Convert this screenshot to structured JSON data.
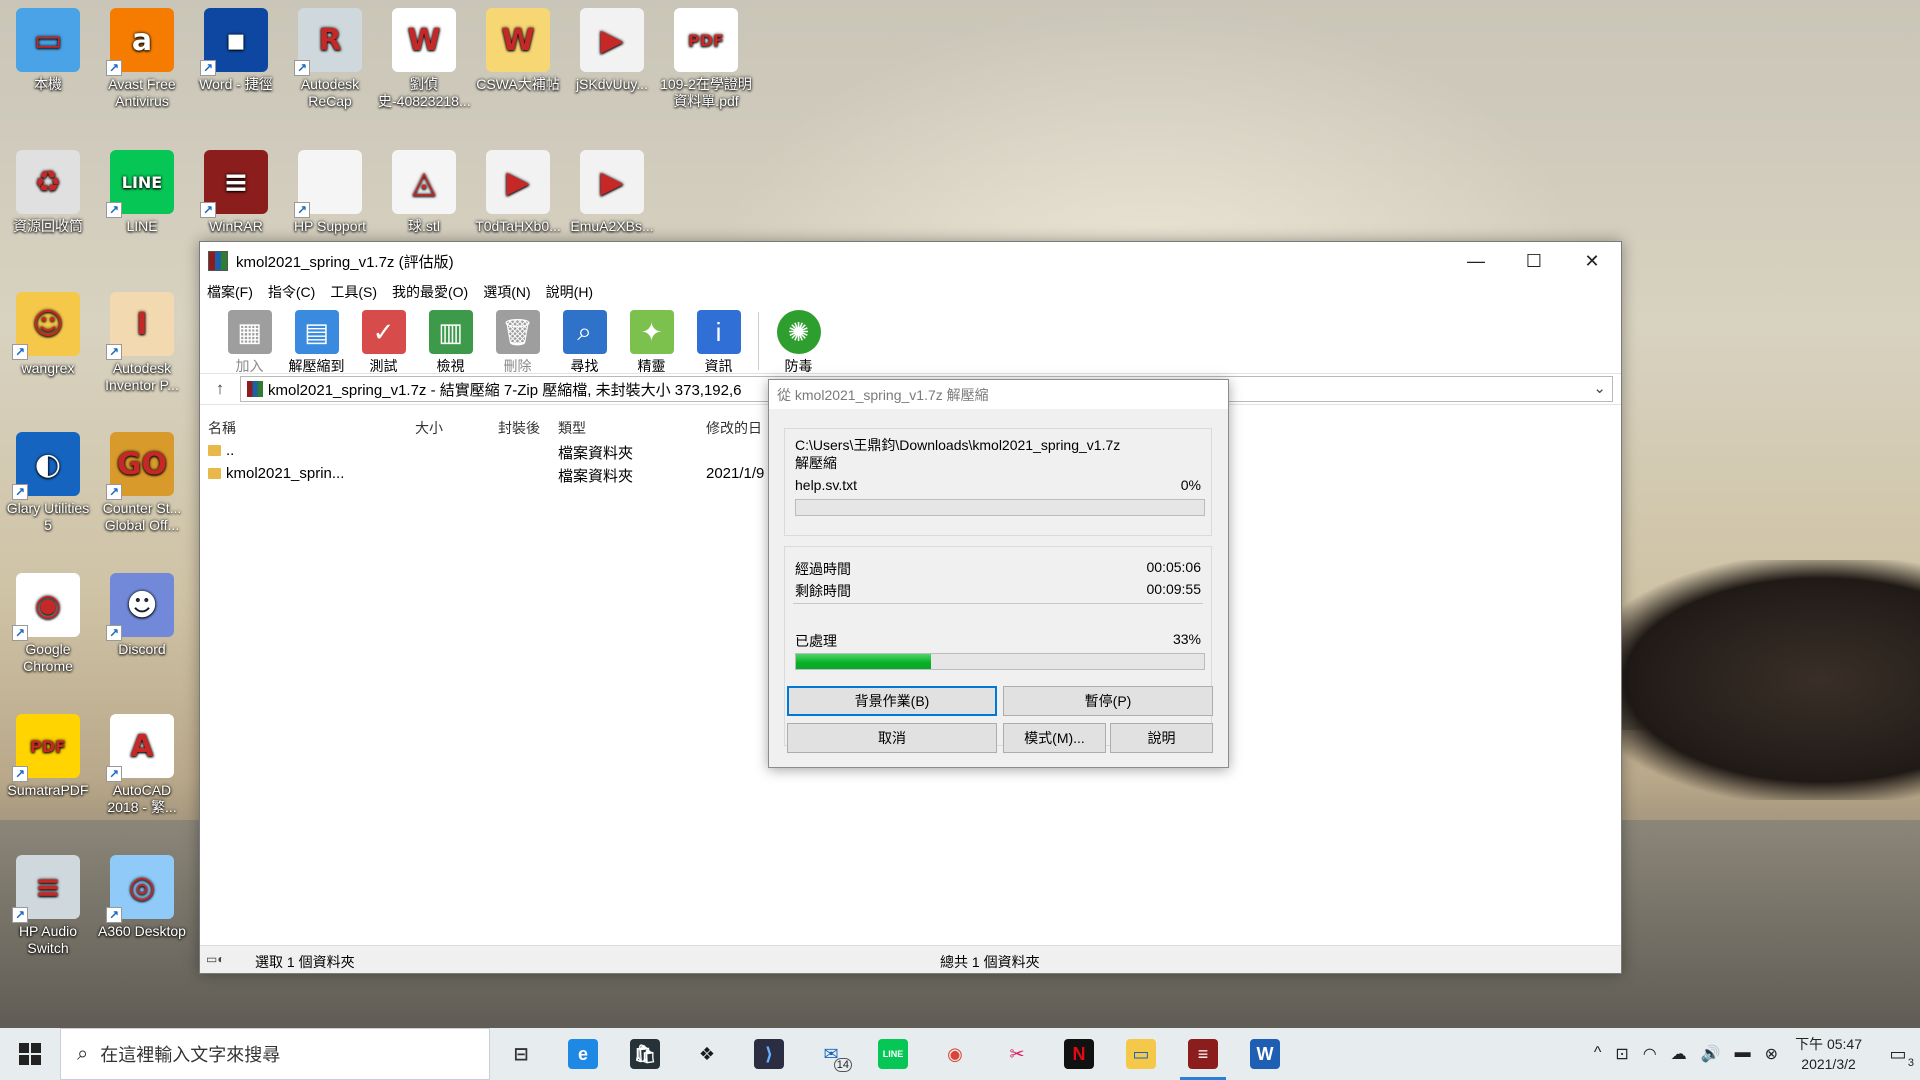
{
  "desktop": {
    "icons": [
      {
        "label": "本機",
        "color": "#4aa3e6",
        "glyph": "▭",
        "name": "this-pc-icon"
      },
      {
        "label": "Avast Free Antivirus",
        "color": "#f57c00",
        "glyph": "a",
        "name": "avast-icon"
      },
      {
        "label": "Word - 捷徑",
        "color": "#0d47a1",
        "glyph": "▪",
        "name": "word-shortcut-icon"
      },
      {
        "label": "Autodesk ReCap",
        "color": "#cfd8dc",
        "glyph": "R",
        "name": "recap-icon"
      },
      {
        "label": "劉偵史-40823218...",
        "color": "#ffffff",
        "glyph": "W",
        "name": "word-doc-icon"
      },
      {
        "label": "CSWA大補帖",
        "color": "#f7d774",
        "glyph": "W",
        "name": "word-folder-icon"
      },
      {
        "label": "jSKdvUuy...",
        "color": "#f2f2f2",
        "glyph": "▶",
        "name": "video-file-icon"
      },
      {
        "label": "109-2在學證明資料單.pdf",
        "color": "#ffffff",
        "glyph": "PDF",
        "name": "pdf-file-icon"
      },
      {
        "label": "資源回收筒",
        "color": "#e0e0e0",
        "glyph": "♻",
        "name": "recycle-bin-icon"
      },
      {
        "label": "LINE",
        "color": "#06c755",
        "glyph": "LINE",
        "name": "line-icon"
      },
      {
        "label": "WinRAR",
        "color": "#8b1d1d",
        "glyph": "≡",
        "name": "winrar-icon"
      },
      {
        "label": "HP Support",
        "color": "#f5f5f5",
        "glyph": " ",
        "name": "hp-support-icon"
      },
      {
        "label": "球.stl",
        "color": "#f5f5f5",
        "glyph": "◬",
        "name": "stl-file-icon"
      },
      {
        "label": "T0dTaHXb0...",
        "color": "#f2f2f2",
        "glyph": "▶",
        "name": "video-file-icon"
      },
      {
        "label": "EmuA2XBs...",
        "color": "#f2f2f2",
        "glyph": "▶",
        "name": "video-file-icon"
      },
      {
        "label": "wangrex",
        "color": "#f6c84a",
        "glyph": "☺",
        "name": "user-folder-icon"
      },
      {
        "label": "Autodesk Inventor P...",
        "color": "#f2d9b0",
        "glyph": "I",
        "name": "inventor-icon"
      },
      {
        "label": "Glary Utilities 5",
        "color": "#1565c0",
        "glyph": "◐",
        "name": "glary-icon"
      },
      {
        "label": "Counter St... Global Off...",
        "color": "#d89a2b",
        "glyph": "GO",
        "name": "csgo-icon"
      },
      {
        "label": "Google Chrome",
        "color": "#ffffff",
        "glyph": "◉",
        "name": "chrome-icon"
      },
      {
        "label": "Discord",
        "color": "#7289da",
        "glyph": "☻",
        "name": "discord-icon"
      },
      {
        "label": "SumatraPDF",
        "color": "#ffd400",
        "glyph": "PDF",
        "name": "sumatra-icon"
      },
      {
        "label": "AutoCAD 2018 - 繁...",
        "color": "#ffffff",
        "glyph": "A",
        "name": "autocad-icon"
      },
      {
        "label": "HP Audio Switch",
        "color": "#cfd8dc",
        "glyph": "≡",
        "name": "hp-audio-icon"
      },
      {
        "label": "A360 Desktop",
        "color": "#90caf9",
        "glyph": "◎",
        "name": "a360-icon"
      }
    ]
  },
  "winrar": {
    "title": "kmol2021_spring_v1.7z (評估版)",
    "controls": {
      "minimize": "—",
      "maximize": "☐",
      "close": "✕"
    },
    "menu": [
      "檔案(F)",
      "指令(C)",
      "工具(S)",
      "我的最愛(O)",
      "選項(N)",
      "說明(H)"
    ],
    "toolbar": [
      {
        "label": "加入",
        "glyph": "▦",
        "color": "#9e9e9e",
        "disabled": true,
        "name": "add-button"
      },
      {
        "label": "解壓縮到",
        "glyph": "▤",
        "color": "#3a8be0",
        "disabled": false,
        "name": "extract-to-button"
      },
      {
        "label": "測試",
        "glyph": "✓",
        "color": "#d84b4b",
        "disabled": false,
        "name": "test-button"
      },
      {
        "label": "檢視",
        "glyph": "▥",
        "color": "#3d9a4a",
        "disabled": false,
        "name": "view-button"
      },
      {
        "label": "刪除",
        "glyph": "🗑",
        "color": "#9e9e9e",
        "disabled": true,
        "name": "delete-button"
      },
      {
        "label": "尋找",
        "glyph": "⌕",
        "color": "#2f72c9",
        "disabled": false,
        "name": "find-button"
      },
      {
        "label": "精靈",
        "glyph": "✦",
        "color": "#7cc04d",
        "disabled": false,
        "name": "wizard-button"
      },
      {
        "label": "資訊",
        "glyph": "i",
        "color": "#2f6fd6",
        "disabled": false,
        "name": "info-button"
      }
    ],
    "toolbar_extra": {
      "label": "防毒",
      "glyph": "✺",
      "color": "#2e9e2e",
      "name": "antivirus-button"
    },
    "address": "kmol2021_spring_v1.7z - 結實壓縮 7-Zip 壓縮檔, 未封裝大小 373,192,6",
    "columns": [
      "名稱",
      "大小",
      "封裝後",
      "類型",
      "修改的日"
    ],
    "rows": [
      {
        "name": "..",
        "type": "檔案資料夾",
        "date": ""
      },
      {
        "name": "kmol2021_sprin...",
        "type": "檔案資料夾",
        "date": "2021/1/9"
      }
    ],
    "status_left": "選取 1 個資料夾",
    "status_right": "總共 1 個資料夾"
  },
  "dialog": {
    "title": "從 kmol2021_spring_v1.7z 解壓縮",
    "path": "C:\\Users\\王鼎鈞\\Downloads\\kmol2021_spring_v1.7z",
    "action": "解壓縮",
    "file": "help.sv.txt",
    "file_pct": "0%",
    "file_progress": 0,
    "elapsed_label": "經過時間",
    "elapsed": "00:05:06",
    "remaining_label": "剩餘時間",
    "remaining": "00:09:55",
    "processed_label": "已處理",
    "processed_pct": "33%",
    "processed_progress": 0.33,
    "buttons": {
      "background": "背景作業(B)",
      "pause": "暫停(P)",
      "cancel": "取消",
      "mode": "模式(M)...",
      "help": "說明"
    }
  },
  "taskbar": {
    "search_placeholder": "在這裡輸入文字來搜尋",
    "apps": [
      {
        "name": "task-view-icon",
        "glyph": "⊟",
        "color": "#e7ecef",
        "fg": "#333"
      },
      {
        "name": "edge-icon",
        "glyph": "e",
        "color": "#1e88e5",
        "fg": "#fff"
      },
      {
        "name": "store-icon",
        "glyph": "🛍",
        "color": "#263238",
        "fg": "#fff"
      },
      {
        "name": "dropbox-icon",
        "glyph": "❖",
        "color": "#e7ecef",
        "fg": "#1a1a1a"
      },
      {
        "name": "visual-studio-icon",
        "glyph": "⟩",
        "color": "#2b2d42",
        "fg": "#6ab0ff"
      },
      {
        "name": "mail-icon",
        "glyph": "✉",
        "color": "#e7ecef",
        "fg": "#1565c0",
        "badge": "14"
      },
      {
        "name": "line-taskbar-icon",
        "glyph": "LINE",
        "color": "#06c755",
        "fg": "#fff"
      },
      {
        "name": "chrome-taskbar-icon",
        "glyph": "◉",
        "color": "#e7ecef",
        "fg": "#db4437"
      },
      {
        "name": "snipping-icon",
        "glyph": "✂",
        "color": "#e7ecef",
        "fg": "#d81b60"
      },
      {
        "name": "netflix-icon",
        "glyph": "N",
        "color": "#111",
        "fg": "#e50914"
      },
      {
        "name": "file-explorer-icon",
        "glyph": "▭",
        "color": "#f6c84a",
        "fg": "#1565c0"
      },
      {
        "name": "winrar-taskbar-icon",
        "glyph": "≡",
        "color": "#8b1d1d",
        "fg": "#fff",
        "active": true
      },
      {
        "name": "word-taskbar-icon",
        "glyph": "W",
        "color": "#1e5fb4",
        "fg": "#fff"
      }
    ],
    "tray_icons": [
      "^",
      "⊡",
      "◠",
      "☁",
      "🔊",
      "▬",
      "⊗"
    ],
    "time": "下午 05:47",
    "date": "2021/3/2",
    "notifications": "3"
  }
}
